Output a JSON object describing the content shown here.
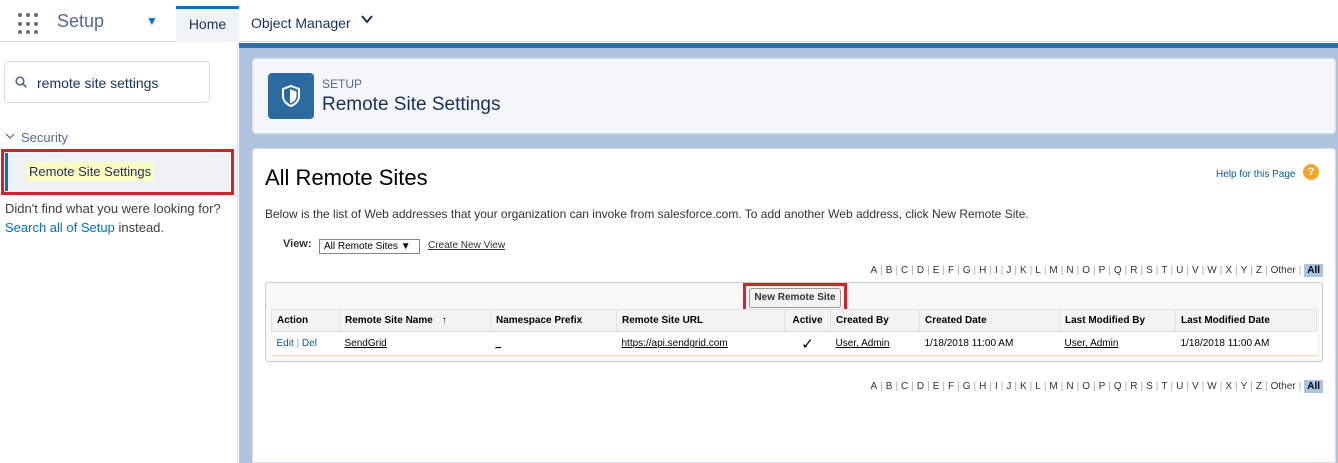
{
  "topbar": {
    "app_name": "Setup",
    "tab_home": "Home",
    "tab_object_manager": "Object Manager"
  },
  "sidebar": {
    "search_value": "remote site settings",
    "tree_section": "Security",
    "tree_item": "Remote Site Settings",
    "not_found_prefix": "Didn't find what you were looking for?",
    "not_found_link": "Search all of Setup",
    "not_found_suffix": "instead."
  },
  "header": {
    "eyebrow": "SETUP",
    "title": "Remote Site Settings"
  },
  "content": {
    "h1": "All Remote Sites",
    "help_link": "Help for this Page",
    "help_icon": "?",
    "intro": "Below is the list of Web addresses that your organization can invoke from salesforce.com. To add another Web address, click New Remote Site.",
    "view_label": "View:",
    "view_selected": "All Remote Sites ▼",
    "create_view_link": "Create New View",
    "alphabet": [
      "A",
      "B",
      "C",
      "D",
      "E",
      "F",
      "G",
      "H",
      "I",
      "J",
      "K",
      "L",
      "M",
      "N",
      "O",
      "P",
      "Q",
      "R",
      "S",
      "T",
      "U",
      "V",
      "W",
      "X",
      "Y",
      "Z",
      "Other"
    ],
    "alphabet_all": "All",
    "new_button": "New Remote Site",
    "columns": {
      "action": "Action",
      "name": "Remote Site Name",
      "name_sort": "↑",
      "namespace": "Namespace Prefix",
      "url": "Remote Site URL",
      "active": "Active",
      "created_by": "Created By",
      "created_date": "Created Date",
      "modified_by": "Last Modified By",
      "modified_date": "Last Modified Date"
    },
    "rows": [
      {
        "edit": "Edit",
        "sep": "|",
        "del": "Del",
        "name": "SendGrid",
        "namespace": "_",
        "url": "https://api.sendgrid.com",
        "active": "✓",
        "created_by": "User, Admin",
        "created_date": "1/18/2018 11:00 AM",
        "modified_by": "User, Admin",
        "modified_date": "1/18/2018 11:00 AM"
      }
    ]
  }
}
